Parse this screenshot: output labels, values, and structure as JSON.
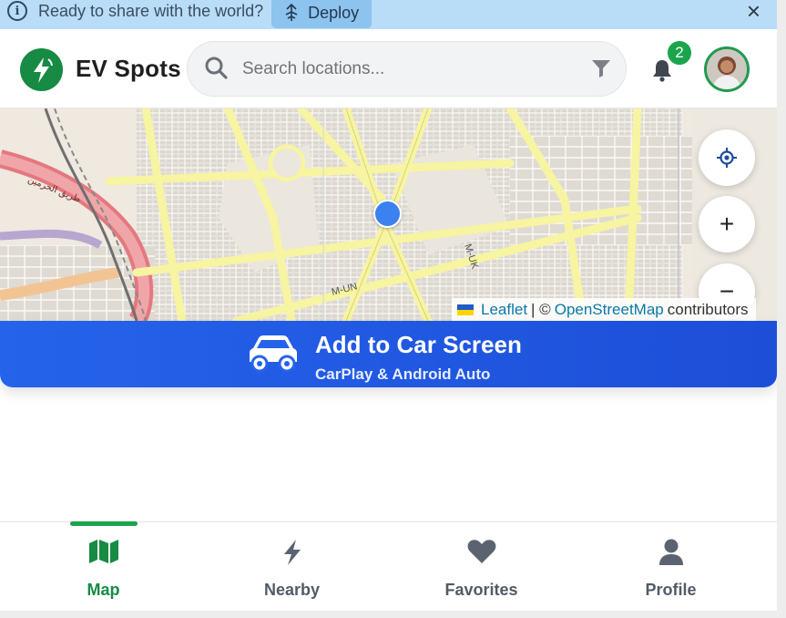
{
  "banner": {
    "message": "Ready to share with the world?",
    "deploy_label": "Deploy",
    "info_icon": "i"
  },
  "header": {
    "brand": "EV Spots",
    "search_placeholder": "Search locations...",
    "notification_count": "2"
  },
  "map": {
    "attribution": {
      "leaflet": "Leaflet",
      "separator": "| ©",
      "osm": "OpenStreetMap",
      "suffix": "contributors"
    },
    "labels": {
      "road1": "M-UN",
      "road2": "M-UK",
      "road3": "طريق الحرمين"
    },
    "zoom_in": "+",
    "zoom_out": "−"
  },
  "car_banner": {
    "title": "Add to Car Screen",
    "subtitle": "CarPlay & Android Auto"
  },
  "nav": {
    "items": [
      {
        "label": "Map",
        "icon": "map-icon",
        "active": true
      },
      {
        "label": "Nearby",
        "icon": "bolt-icon",
        "active": false
      },
      {
        "label": "Favorites",
        "icon": "heart-icon",
        "active": false
      },
      {
        "label": "Profile",
        "icon": "user-icon",
        "active": false
      }
    ]
  },
  "colors": {
    "brand_green": "#178a43",
    "car_banner_blue": "#2563eb",
    "banner_bg": "#b9dcf7",
    "location_dot": "#3b82f0"
  }
}
